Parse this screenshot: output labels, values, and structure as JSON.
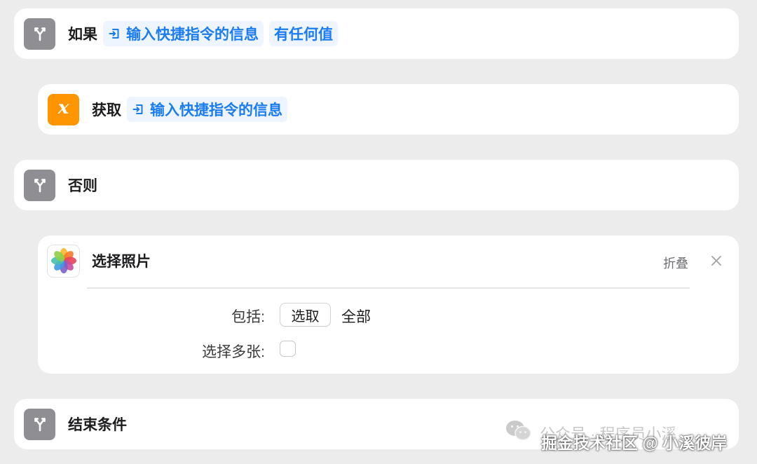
{
  "colors": {
    "background": "#ececec",
    "card": "#ffffff",
    "accent_blue": "#1a7cf0",
    "token_bg": "#eef5fe",
    "icon_grey": "#8e8e93",
    "icon_orange": "#ff9500"
  },
  "actions": {
    "if": {
      "icon": "branch-icon",
      "title": "如果",
      "variable_icon": "shortcut-input-icon",
      "variable": "输入快捷指令的信息",
      "condition": "有任何值"
    },
    "get_variable": {
      "icon": "variable-x-icon",
      "icon_glyph": "x",
      "title": "获取",
      "variable_icon": "shortcut-input-icon",
      "variable": "输入快捷指令的信息"
    },
    "otherwise": {
      "icon": "branch-icon",
      "title": "否则"
    },
    "select_photos": {
      "icon": "photos-app-icon",
      "title": "选择照片",
      "collapse_label": "折叠",
      "close_icon": "close-icon",
      "include_label": "包括:",
      "include_button": "选取",
      "include_value": "全部",
      "multiple_label": "选择多张:",
      "multiple_checked": false
    },
    "end_if": {
      "icon": "branch-icon",
      "title": "结束条件"
    }
  },
  "watermark": {
    "icon": "wechat-icon",
    "text": "公众号 · 程序员小溪"
  },
  "credit": "掘金技术社区 @ 小溪彼岸"
}
